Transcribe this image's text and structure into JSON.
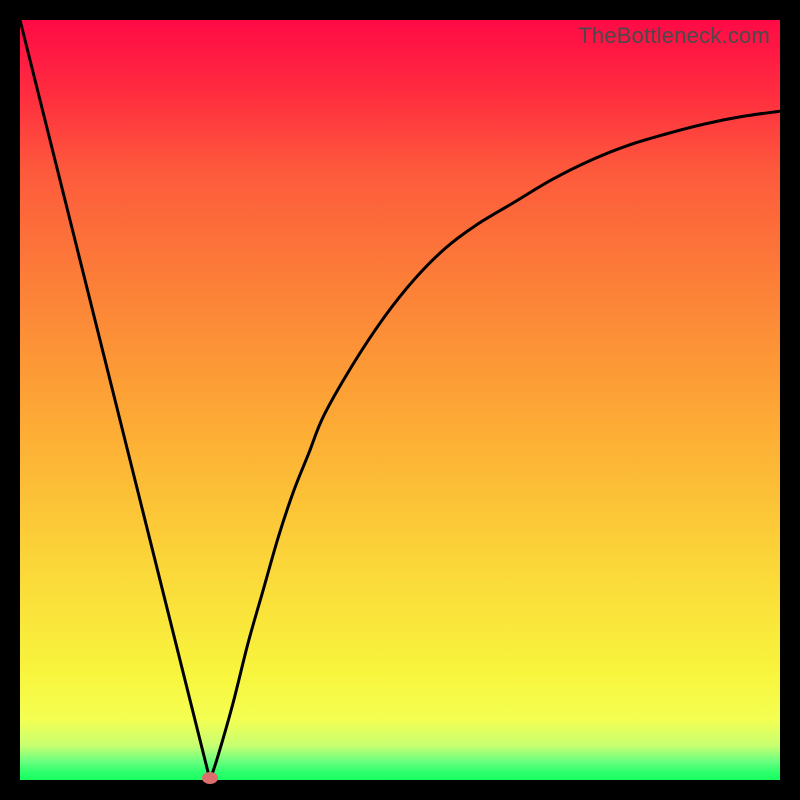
{
  "watermark": "TheBottleneck.com",
  "colors": {
    "background": "#000000",
    "curve_stroke": "#000000",
    "dot_fill": "#dd6e6e",
    "gradient_top": "#ff0a46",
    "gradient_bottom": "#18ff60"
  },
  "chart_data": {
    "type": "line",
    "title": "",
    "xlabel": "",
    "ylabel": "",
    "xlim": [
      0,
      100
    ],
    "ylim": [
      0,
      100
    ],
    "x": [
      0,
      2,
      4,
      6,
      8,
      10,
      12,
      14,
      16,
      18,
      20,
      22,
      23,
      24,
      25,
      26,
      28,
      30,
      32,
      34,
      36,
      38,
      40,
      44,
      48,
      52,
      56,
      60,
      65,
      70,
      75,
      80,
      85,
      90,
      95,
      100
    ],
    "values": [
      100,
      92,
      84,
      76,
      68,
      60,
      52,
      44,
      36,
      28,
      20,
      12,
      7,
      3,
      0,
      3,
      10,
      18,
      25,
      32,
      38,
      43,
      48,
      55,
      61,
      66,
      70,
      73,
      76,
      79,
      81.5,
      83.5,
      85,
      86.3,
      87.3,
      88
    ],
    "marker": {
      "x": 25,
      "y": 0
    },
    "annotations": [],
    "legend": []
  }
}
